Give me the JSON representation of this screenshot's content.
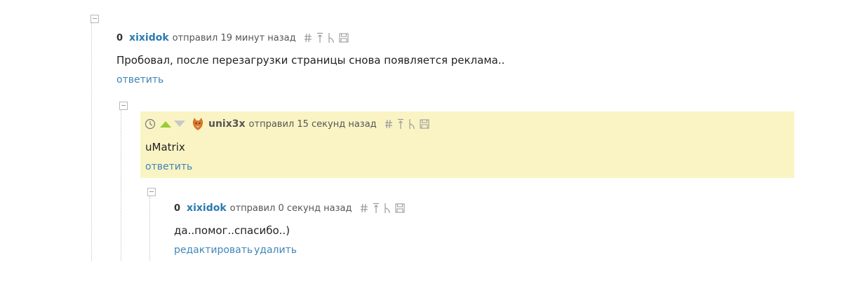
{
  "comments": [
    {
      "score": "0",
      "author": "xixidok",
      "posted": "отправил 19 минут назад",
      "text": "Пробовал, после перезагрузки страницы снова появляется реклама..",
      "actions": [
        "ответить"
      ]
    },
    {
      "author": "unix3x",
      "posted": "отправил 15 секунд назад",
      "text": "uMatrix",
      "actions": [
        "ответить"
      ]
    },
    {
      "score": "0",
      "author": "xixidok",
      "posted": "отправил 0 секунд назад",
      "text": "да..помог..спасибо..)",
      "actions": [
        "редактировать",
        "удалить"
      ]
    }
  ],
  "icons": [
    "collapse-icon",
    "hash-icon",
    "parent-arrow-icon",
    "thread-icon",
    "save-icon",
    "clock-icon",
    "upvote-icon",
    "downvote-icon"
  ],
  "colors": {
    "author": "#2a7ab0",
    "link": "#3f86b8",
    "highlight": "#faf4c4",
    "upvote": "#9acd32",
    "downvote": "#c8c8c8"
  }
}
